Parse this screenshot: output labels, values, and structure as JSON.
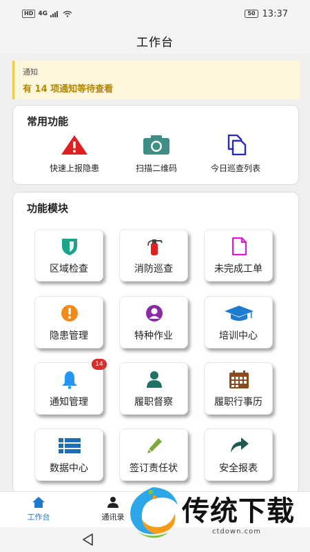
{
  "status_bar": {
    "network": "4G",
    "hd": "HD",
    "battery": "50",
    "time": "13:37"
  },
  "header": {
    "title": "工作台"
  },
  "notice": {
    "title": "通知",
    "message": "有 14 项通知等待查看"
  },
  "common": {
    "title": "常用功能",
    "items": [
      {
        "label": "快速上报隐患",
        "icon": "warning-icon",
        "color": "#e02020"
      },
      {
        "label": "扫描二维码",
        "icon": "camera-icon",
        "color": "#3d8f85"
      },
      {
        "label": "今日巡查列表",
        "icon": "copy-icon",
        "color": "#2a2ab8"
      }
    ]
  },
  "modules": {
    "title": "功能模块",
    "items": [
      {
        "label": "区域检查",
        "icon": "shield-icon",
        "color": "#1aa58a"
      },
      {
        "label": "消防巡查",
        "icon": "fire-extinguisher-icon",
        "color": "#e02020"
      },
      {
        "label": "未完成工单",
        "icon": "document-icon",
        "color": "#d61ecf"
      },
      {
        "label": "隐患管理",
        "icon": "exclamation-icon",
        "color": "#f08a1c"
      },
      {
        "label": "特种作业",
        "icon": "user-circle-icon",
        "color": "#8b2aa5"
      },
      {
        "label": "培训中心",
        "icon": "graduation-cap-icon",
        "color": "#1f7ad1"
      },
      {
        "label": "通知管理",
        "icon": "bell-icon",
        "color": "#2196f3",
        "badge": "14"
      },
      {
        "label": "履职督察",
        "icon": "person-icon",
        "color": "#236f66"
      },
      {
        "label": "履职行事历",
        "icon": "calendar-icon",
        "color": "#8a4b1e"
      },
      {
        "label": "数据中心",
        "icon": "list-icon",
        "color": "#1f6db0"
      },
      {
        "label": "签订责任状",
        "icon": "pencil-icon",
        "color": "#7ea83a"
      },
      {
        "label": "安全报表",
        "icon": "share-icon",
        "color": "#1e5a52"
      }
    ]
  },
  "tabs": [
    {
      "label": "工作台",
      "icon": "home-icon",
      "active": true,
      "color": "#1f7ad1"
    },
    {
      "label": "通讯录",
      "icon": "contacts-icon",
      "active": false,
      "color": "#222222"
    }
  ],
  "watermark": {
    "text": "传统下载",
    "url": "ctdown.com"
  }
}
